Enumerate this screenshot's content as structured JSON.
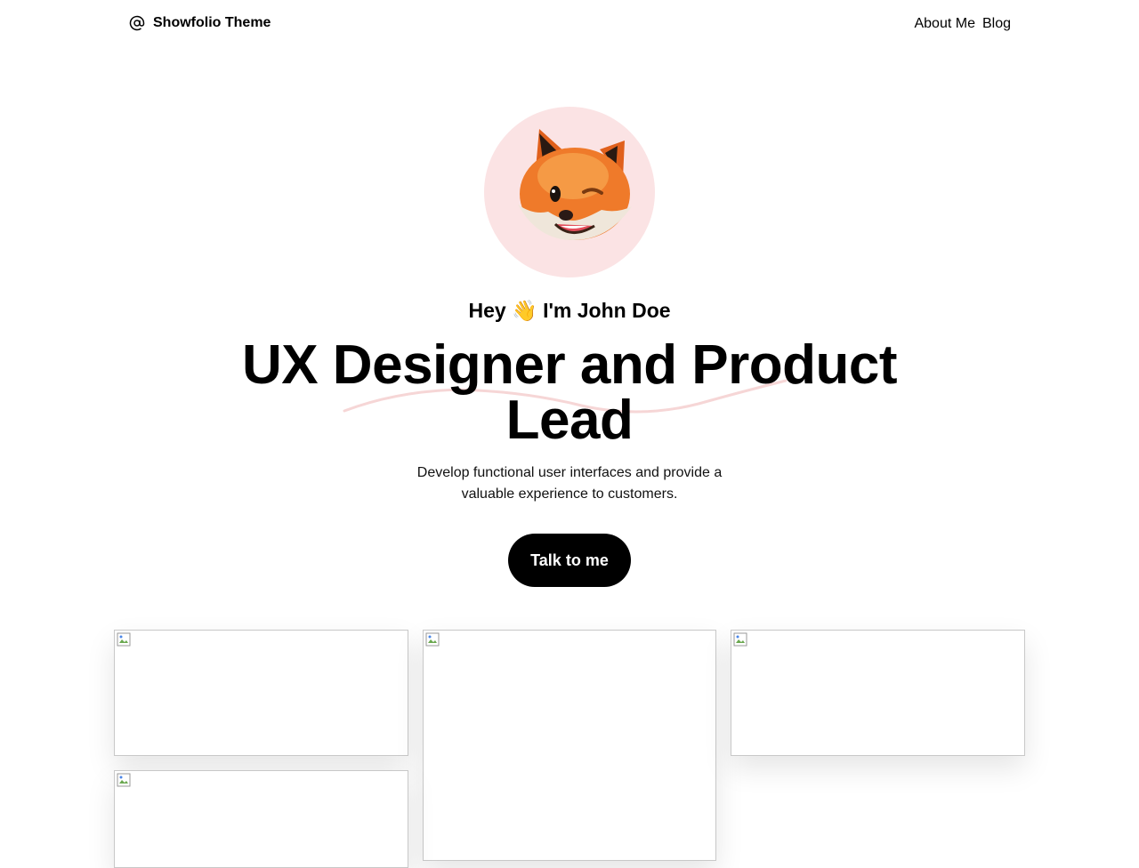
{
  "header": {
    "brand_icon": "at-sign-icon",
    "brand_name": "Showfolio Theme",
    "nav": [
      {
        "label": "About Me"
      },
      {
        "label": "Blog"
      }
    ]
  },
  "hero": {
    "avatar_icon": "fox-avatar",
    "greeting": "Hey 👋 I'm John Doe",
    "headline": "UX Designer and Product Lead",
    "subtitle": "Develop functional user interfaces and provide a valuable experience to customers.",
    "cta_label": "Talk to me"
  },
  "colors": {
    "avatar_bg": "#fbe3e4",
    "squiggle": "#f6d6d6",
    "cta_bg": "#000000",
    "cta_text": "#ffffff"
  },
  "gallery": {
    "items": [
      {
        "icon": "broken-image-icon"
      },
      {
        "icon": "broken-image-icon"
      },
      {
        "icon": "broken-image-icon"
      },
      {
        "icon": "broken-image-icon"
      }
    ]
  }
}
